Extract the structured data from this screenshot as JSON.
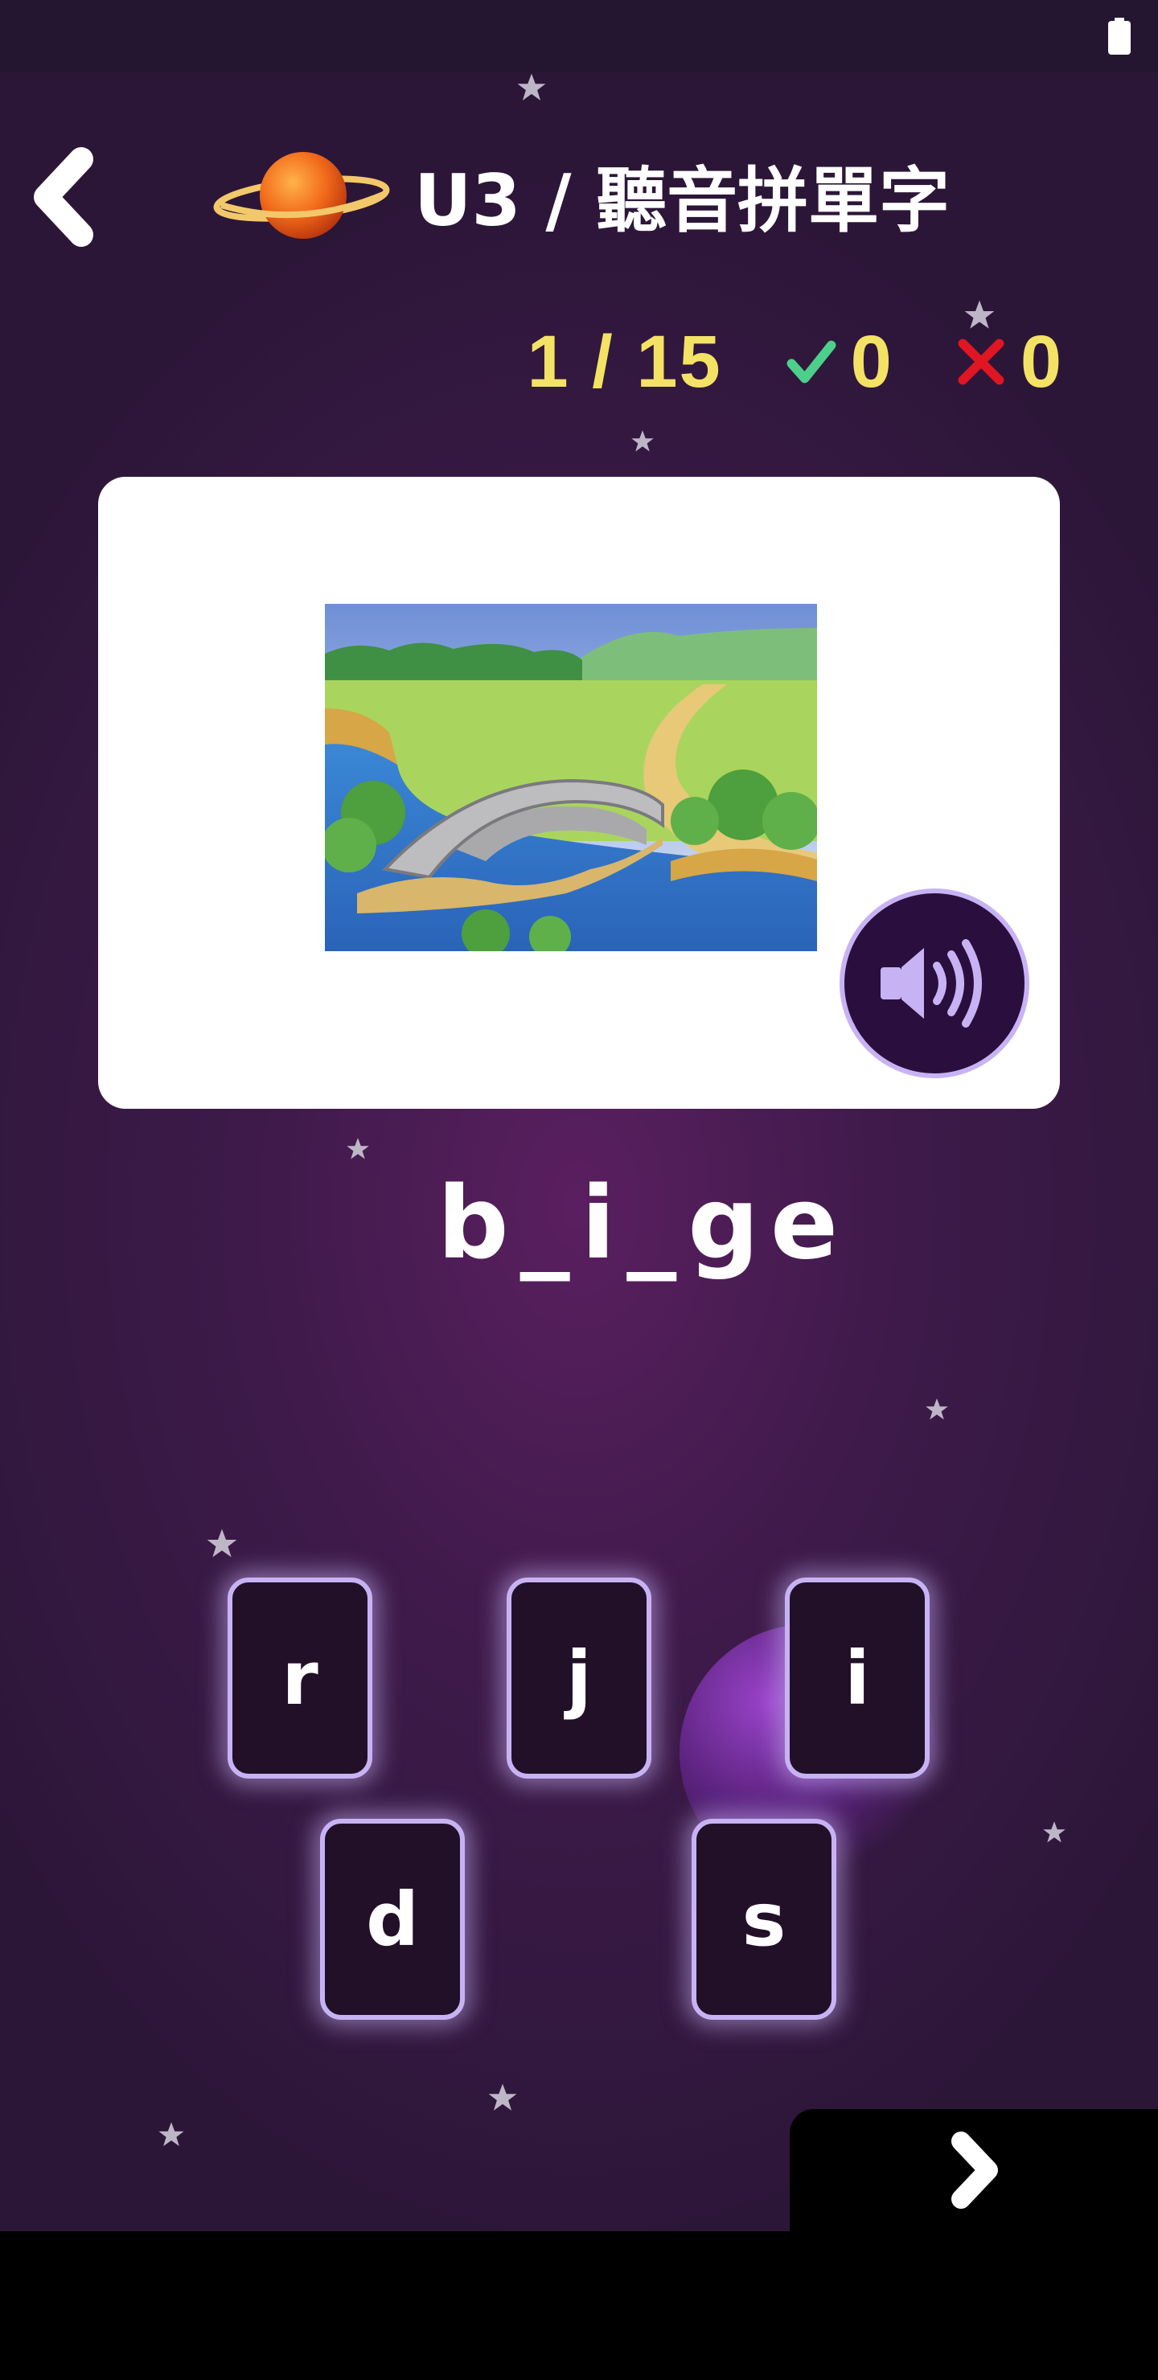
{
  "header": {
    "title": "U3 / 聽音拼單字",
    "back_icon": "chevron-left-icon",
    "logo_icon": "planet-icon"
  },
  "score": {
    "progress": "1 / 15",
    "correct": "0",
    "wrong": "0",
    "correct_color": "#4ccf8a",
    "wrong_color": "#e01622",
    "text_color": "#f4e265"
  },
  "question": {
    "image_subject": "bridge-over-river-illustration",
    "sound_icon": "speaker-icon",
    "word": "b_i_ge"
  },
  "choices": [
    "r",
    "j",
    "i",
    "d",
    "s"
  ],
  "navigation": {
    "next_icon": "chevron-right-icon"
  },
  "colors": {
    "background": "#3e1a4a",
    "tile_border": "#c7b3f4",
    "tile_fill": "#221029"
  }
}
